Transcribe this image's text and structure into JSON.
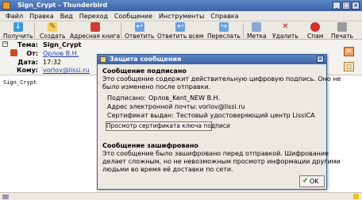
{
  "window": {
    "title": "Sign_Crypt - Thunderbird"
  },
  "menu": [
    "Файл",
    "Правка",
    "Вид",
    "Переход",
    "Сообщение",
    "Инструменты",
    "Справка"
  ],
  "toolbar": {
    "get": "Получить",
    "write": "Создать",
    "address": "Адресная книга",
    "reply": "Ответить",
    "reply_all": "Ответить всем",
    "forward": "Переслать",
    "tag": "Метка",
    "delete": "Удалить",
    "junk": "Спам",
    "print": "Печать"
  },
  "headers": {
    "subject_label": "Тема:",
    "subject": "Sign_Crypt",
    "from_label": "От:",
    "from": "Орлов В.Н.",
    "date_label": "Дата:",
    "date": "17:32",
    "to_label": "Кому:",
    "to": "vorlov@lissi.ru"
  },
  "body": {
    "text": "Sign_Crypt"
  },
  "dialog": {
    "title": "Защита сообщения",
    "signed_heading": "Сообщение подписано",
    "signed_text_1": "Это сообщение содержит действительную цифровую подпись. Оно не",
    "signed_text_2": "было изменено после отправки.",
    "signed_by_label": "Подписано:",
    "signed_by": "Орлов_Kent_NEW В.Н.",
    "email_label": "Адрес электронной почты:",
    "email": "vorlov@lissi.ru",
    "issuer_label": "Сертификат выдан:",
    "issuer": "Тестовый удостоверяющий центр LissiCA",
    "cert_button": "Просмотр сертификата ключа подписи",
    "encrypted_heading": "Сообщение зашифровано",
    "encrypted_text_1": "Это сообщение было зашифровано перед отправкой. Шифрование",
    "encrypted_text_2": "делает сложным, но не невозможным просмотр информации другими",
    "encrypted_text_3": "людьми во время её доставки по сети.",
    "ok": "OK"
  }
}
